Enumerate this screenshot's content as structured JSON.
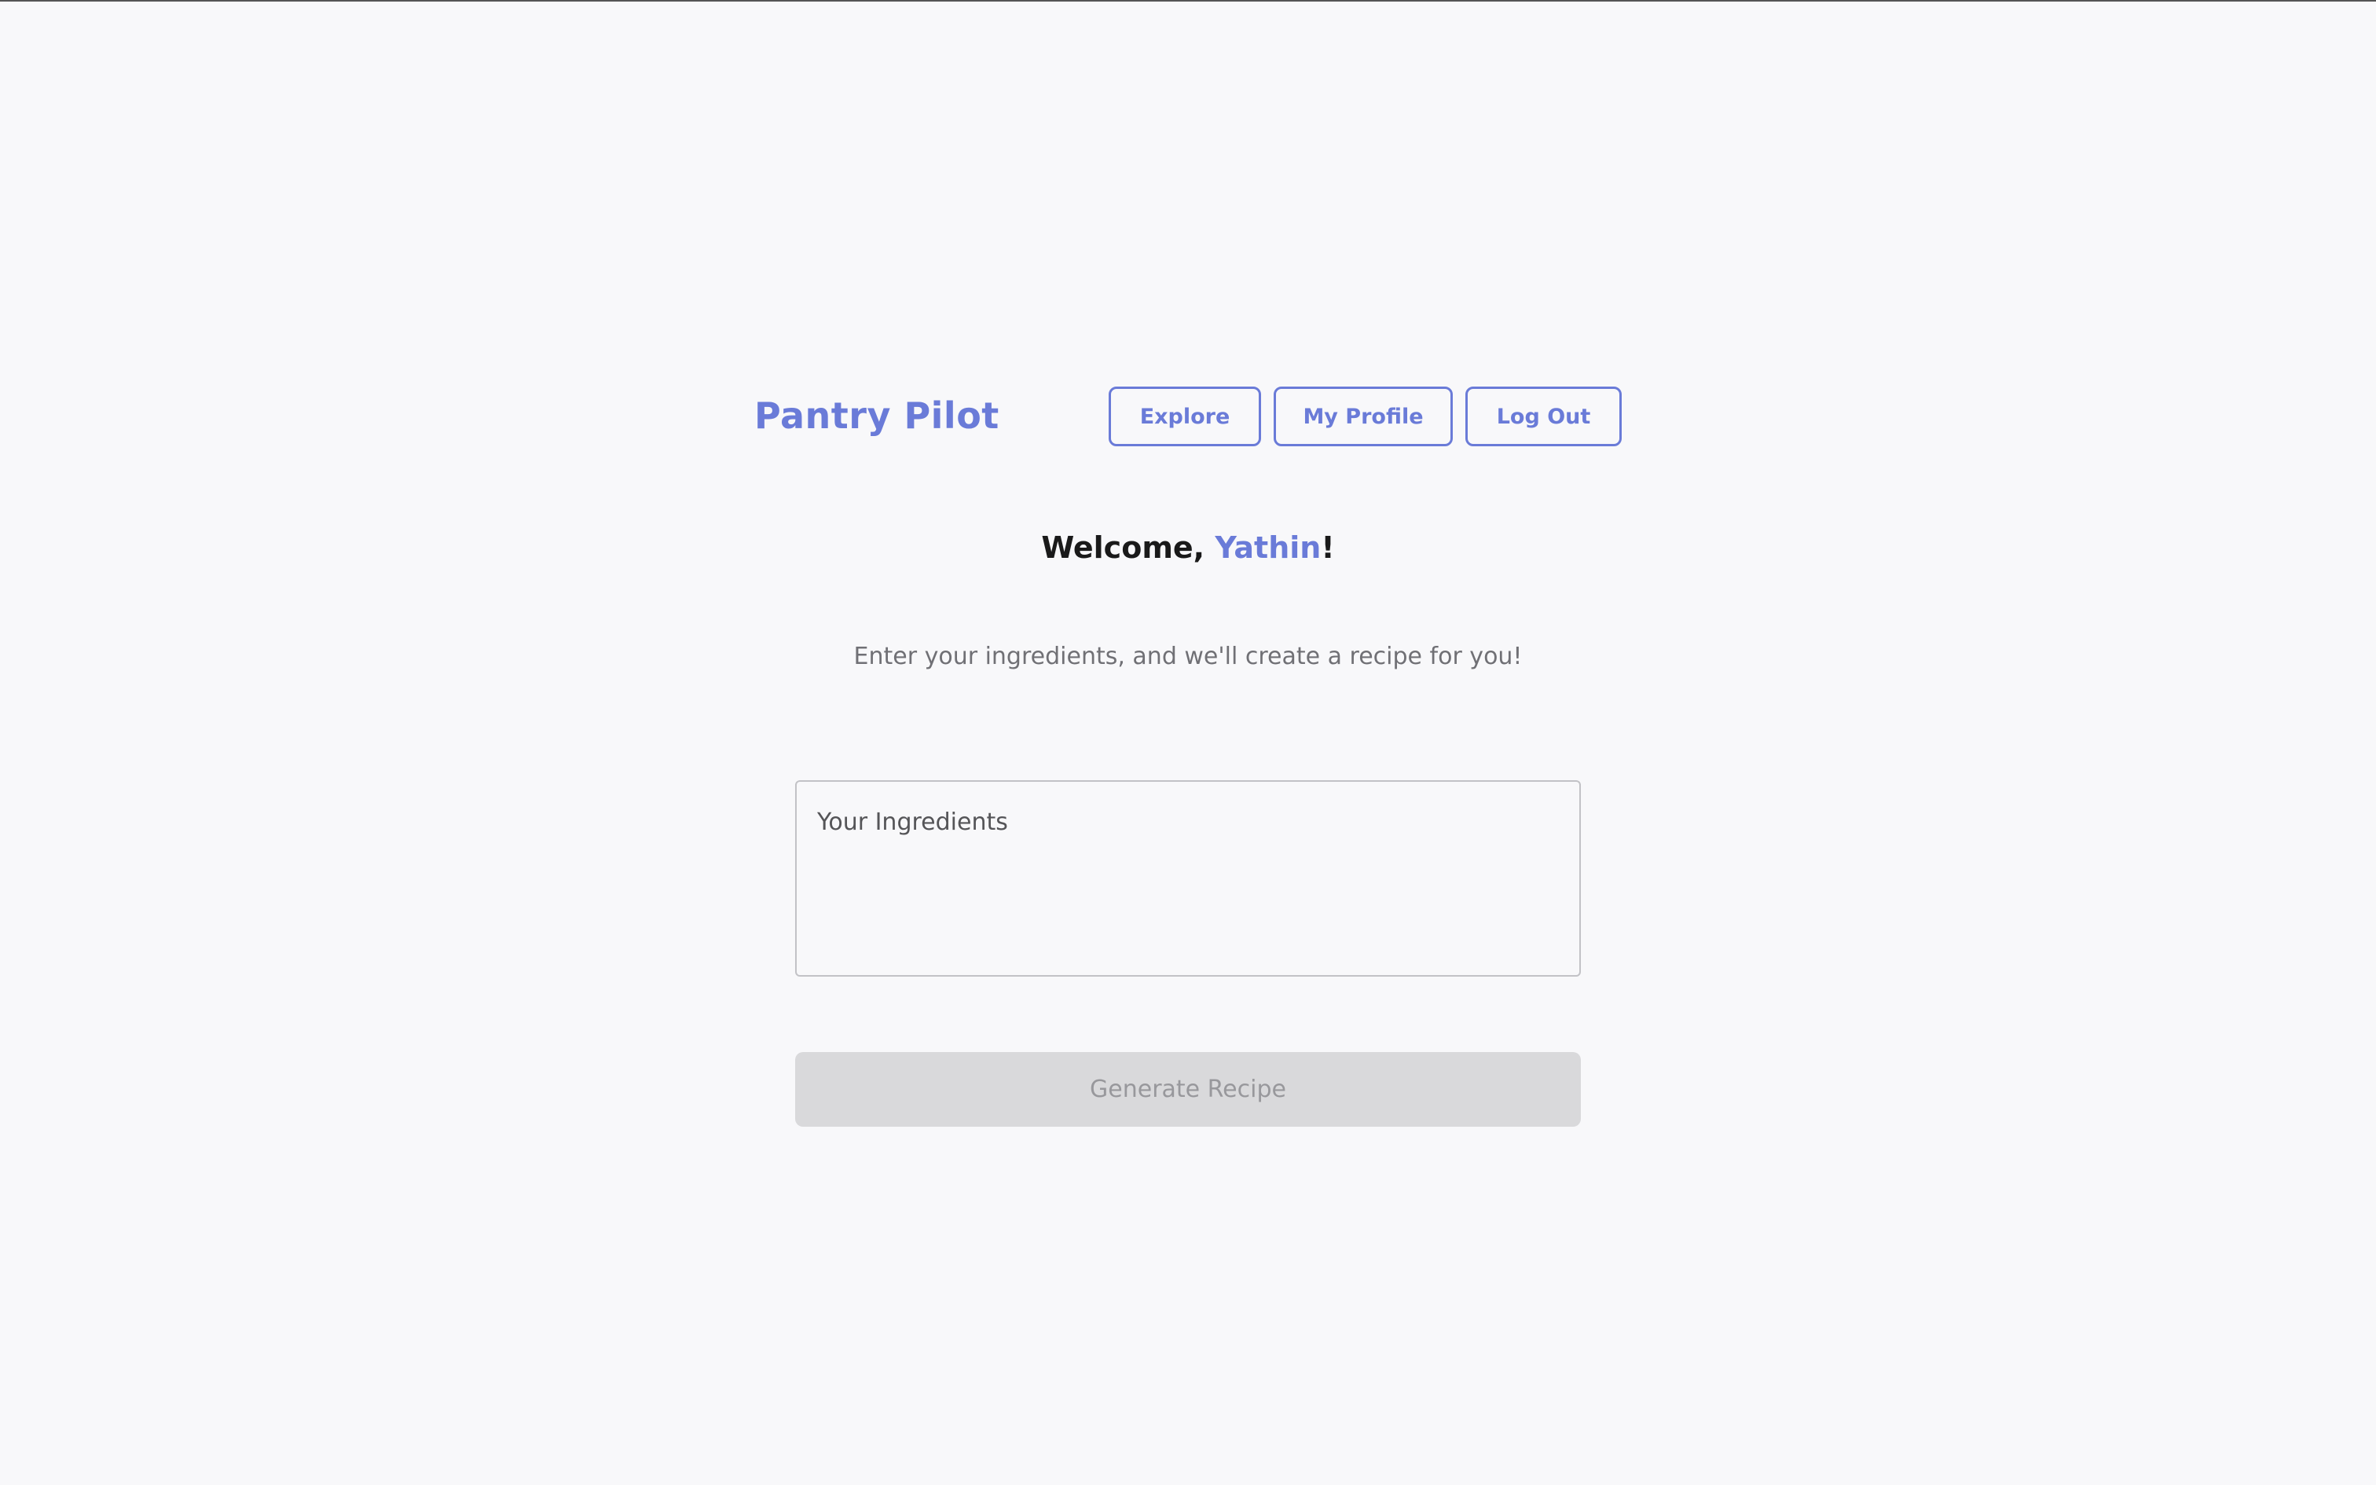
{
  "header": {
    "logo_text": "Pantry Pilot",
    "nav": {
      "explore_label": "Explore",
      "profile_label": "My Profile",
      "logout_label": "Log Out"
    }
  },
  "main": {
    "welcome_prefix": "Welcome, ",
    "user_name": "Yathin",
    "welcome_suffix": "!",
    "subtitle": "Enter your ingredients, and we'll create a recipe for you!",
    "ingredients_placeholder": "Your Ingredients",
    "ingredients_value": "",
    "generate_label": "Generate Recipe"
  },
  "colors": {
    "accent": "#6a7bd8",
    "background": "#f8f8fa",
    "disabled_button": "#d9d9db",
    "disabled_text": "#98989c"
  }
}
